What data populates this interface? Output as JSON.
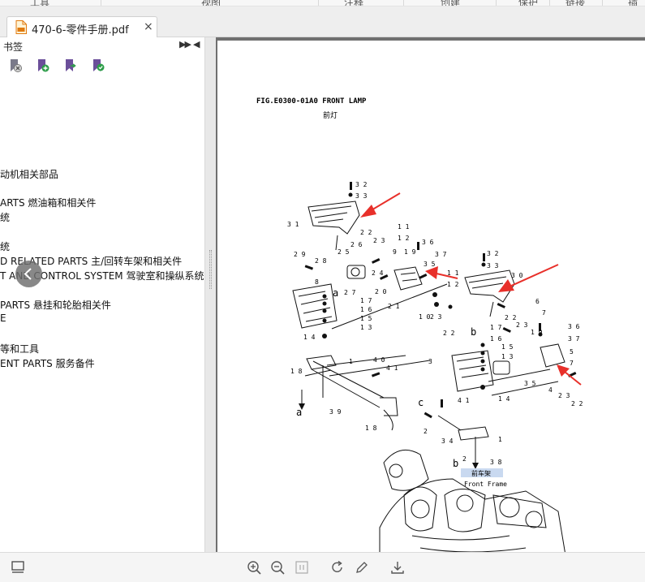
{
  "ribbon": {
    "items": [
      "工具",
      "视图",
      "注释",
      "创建",
      "保护",
      "链接",
      "插入"
    ]
  },
  "tab": {
    "title": "470-6-零件手册.pdf",
    "close_glyph": "×"
  },
  "sidebar": {
    "title": "书签",
    "bookmarks": [
      "动机相关部品",
      "ARTS 燃油箱和相关件",
      "统",
      "统",
      "D RELATED  PARTS 主/回转车架和相关件",
      "T AND CONTROL SYSTEM  驾驶室和操纵系统",
      "PARTS 悬挂和轮胎相关件",
      "E",
      "等和工具",
      "ENT PARTS 服务备件"
    ]
  },
  "document": {
    "fig_title": "FIG.E0300-01A0 FRONT LAMP",
    "fig_subtitle": "前灯",
    "frame_cn": "前车架",
    "frame_en": "Front Frame",
    "letters": [
      "a",
      "a",
      "b",
      "b",
      "c",
      "c"
    ],
    "part_numbers": [
      "3 2",
      "3 3",
      "3 1",
      "2 2",
      "1 1",
      "1 2",
      "2 3",
      "9",
      "1 9",
      "3 6",
      "2 9",
      "2 8",
      "2 5",
      "2 6",
      "2 4",
      "3 5",
      "3 7",
      "1 1",
      "1 2",
      "2 0",
      "2 1",
      "1 0",
      "2 3",
      "2 2",
      "8",
      "2 7",
      "1 7",
      "1 6",
      "1 5",
      "1 3",
      "1 4",
      "1",
      "1 8",
      "4 0",
      "4 1",
      "3 9",
      "1 8",
      "3 2",
      "3 3",
      "3 0",
      "6",
      "7",
      "2 2",
      "2 3",
      "3 6",
      "3 7",
      "1 6",
      "1 7",
      "1 5",
      "1 3",
      "1 9",
      "3",
      "5",
      "7",
      "3 5",
      "1 4",
      "4",
      "2 3",
      "2 2",
      "4 1",
      "2",
      "3 4",
      "1",
      "2",
      "3 8"
    ]
  },
  "colors": {
    "arrow": "#e8302a",
    "frame_label_bg": "#c9d9f0"
  }
}
